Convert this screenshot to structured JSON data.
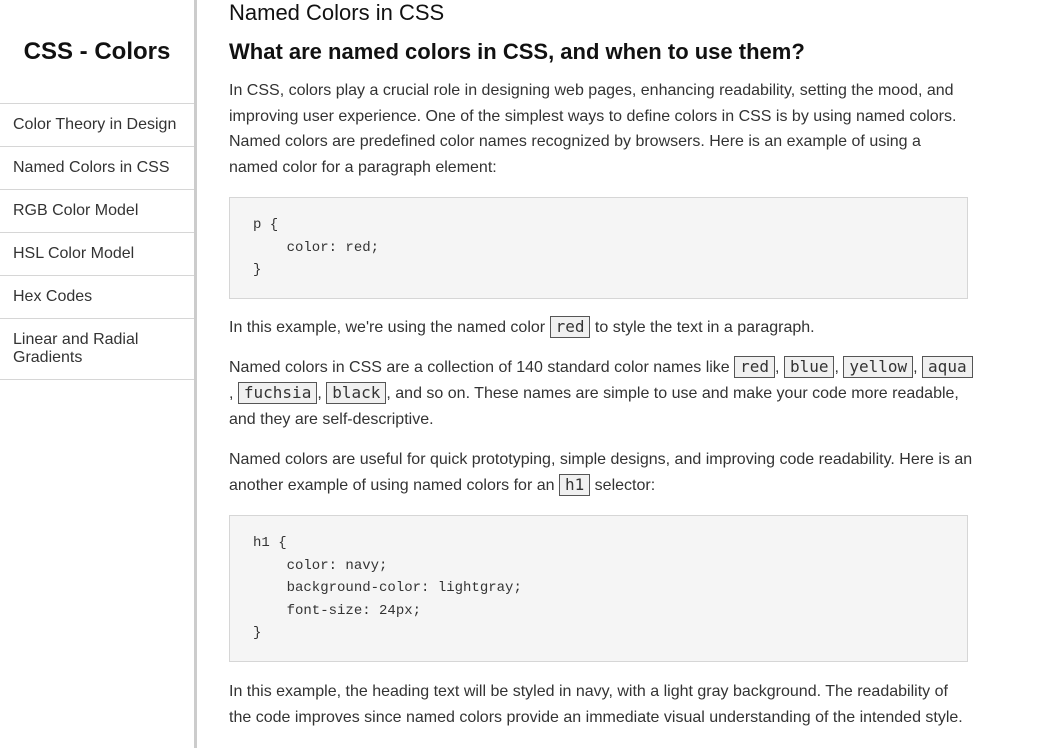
{
  "sidebar": {
    "title": "CSS - Colors",
    "items": [
      {
        "label": "Color Theory in Design"
      },
      {
        "label": "Named Colors in CSS"
      },
      {
        "label": "RGB Color Model"
      },
      {
        "label": "HSL Color Model"
      },
      {
        "label": "Hex Codes"
      },
      {
        "label": "Linear and Radial Gradients"
      }
    ]
  },
  "main": {
    "heading": "Named Colors in CSS",
    "section_title": "What are named colors in CSS, and when to use them?",
    "intro": "In CSS, colors play a crucial role in designing web pages, enhancing readability, setting the mood, and improving user experience. One of the simplest ways to define colors in CSS is by using named colors. Named colors are predefined color names recognized by browsers. Here is an example of using a named color for a paragraph element:",
    "code1": "p {\n    color: red;\n}",
    "example1": {
      "before": "In this example, we're using the named color ",
      "code": "red",
      "after": " to style the text in a paragraph."
    },
    "list_para": {
      "before": "Named colors in CSS are a collection of 140 standard color names like ",
      "colors": [
        "red",
        "blue",
        "yellow",
        "aqua",
        "fuchsia",
        "black"
      ],
      "sep": ", ",
      "after": ", and so on. These names are simple to use and make your code more readable, and they are self-descriptive."
    },
    "para3": {
      "before": "Named colors are useful for quick prototyping, simple designs, and improving code readability. Here is an another example of using named colors for an ",
      "code": "h1",
      "after": " selector:"
    },
    "code2": "h1 {\n    color: navy;\n    background-color: lightgray;\n    font-size: 24px;\n}",
    "para4": "In this example, the heading text will be styled in navy, with a light gray background. The readability of the code improves since named colors provide an immediate visual understanding of the intended style."
  }
}
